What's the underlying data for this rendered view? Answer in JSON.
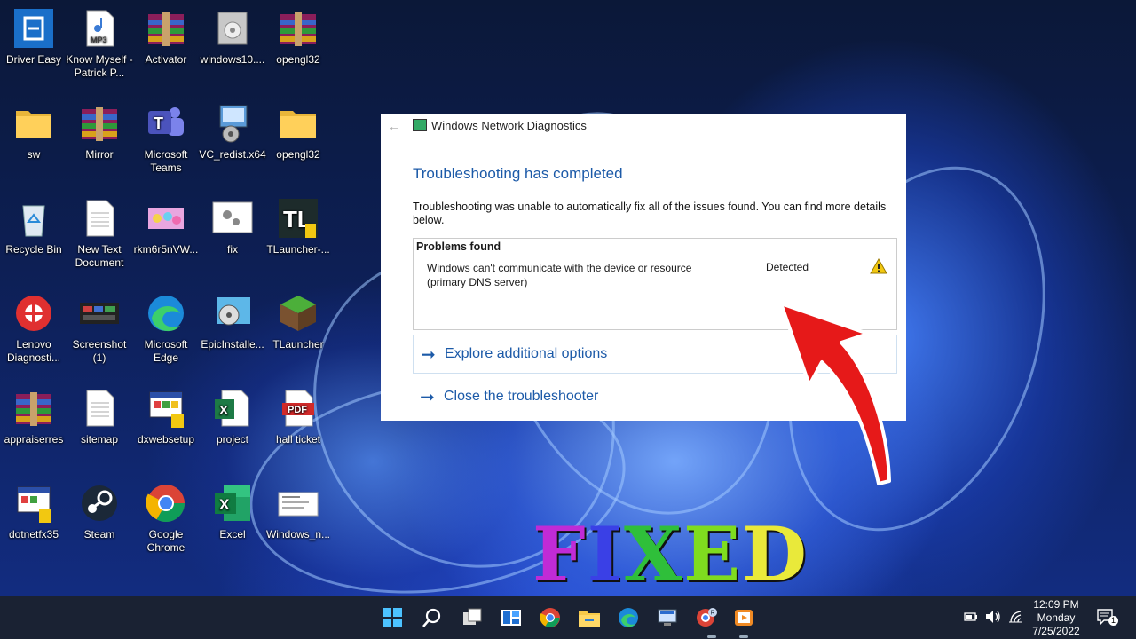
{
  "desktop_icons": [
    {
      "label": "Driver Easy",
      "icon": "driver-easy-icon"
    },
    {
      "label": "Know Myself - Patrick P...",
      "icon": "mp3-file-icon",
      "badge": "MP3"
    },
    {
      "label": "Activator",
      "icon": "winrar-icon"
    },
    {
      "label": "windows10....",
      "icon": "installer-icon"
    },
    {
      "label": "opengl32",
      "icon": "winrar-icon"
    },
    {
      "label": "sw",
      "icon": "folder-icon"
    },
    {
      "label": "Mirror",
      "icon": "winrar-icon"
    },
    {
      "label": "Microsoft Teams",
      "icon": "teams-icon"
    },
    {
      "label": "VC_redist.x64",
      "icon": "setup-icon"
    },
    {
      "label": "opengl32",
      "icon": "folder-icon"
    },
    {
      "label": "Recycle Bin",
      "icon": "recycle-bin-icon"
    },
    {
      "label": "New Text Document",
      "icon": "text-document-icon"
    },
    {
      "label": "rkm6r5nVW...",
      "icon": "image-file-icon"
    },
    {
      "label": "fix",
      "icon": "settings-file-icon"
    },
    {
      "label": "TLauncher-...",
      "icon": "tlauncher-installer-icon",
      "badge": "TL"
    },
    {
      "label": "Lenovo Diagnosti...",
      "icon": "lenovo-diagnostics-icon"
    },
    {
      "label": "Screenshot (1)",
      "icon": "screenshot-icon"
    },
    {
      "label": "Microsoft Edge",
      "icon": "edge-icon"
    },
    {
      "label": "EpicInstalle...",
      "icon": "epic-installer-icon"
    },
    {
      "label": "TLauncher",
      "icon": "minecraft-icon"
    },
    {
      "label": "appraiserres",
      "icon": "winrar-icon"
    },
    {
      "label": "sitemap",
      "icon": "text-document-icon"
    },
    {
      "label": "dxwebsetup",
      "icon": "dxwebsetup-icon"
    },
    {
      "label": "project",
      "icon": "excel-file-icon"
    },
    {
      "label": "hall ticket",
      "icon": "pdf-file-icon",
      "badge": "PDF"
    },
    {
      "label": "dotnetfx35",
      "icon": "dotnet-icon"
    },
    {
      "label": "Steam",
      "icon": "steam-icon"
    },
    {
      "label": "Google Chrome",
      "icon": "chrome-icon"
    },
    {
      "label": "Excel",
      "icon": "excel-icon"
    },
    {
      "label": "Windows_n...",
      "icon": "screenshot-file-icon"
    }
  ],
  "dialog": {
    "title": "Windows Network Diagnostics",
    "heading": "Troubleshooting has completed",
    "description": "Troubleshooting was unable to automatically fix all of the issues found. You can find more details below.",
    "problems_header": "Problems found",
    "problem": {
      "text": "Windows can't communicate with the device or resource (primary DNS server)",
      "status": "Detected",
      "icon": "warning-icon"
    },
    "links": [
      {
        "label": "Explore additional options"
      },
      {
        "label": "Close the troubleshooter"
      }
    ]
  },
  "overlay": {
    "fixed_text": [
      "F",
      "I",
      "X",
      "E",
      "D"
    ],
    "fixed_colors": [
      "#c02bd6",
      "#3a40e6",
      "#2fbf3a",
      "#7fdc1f",
      "#e9e93a"
    ],
    "arrow_color": "#e61919"
  },
  "taskbar": {
    "apps": [
      "start-icon",
      "search-icon",
      "task-view-icon",
      "widgets-icon",
      "chrome-icon",
      "file-explorer-icon",
      "edge-icon",
      "network-diagnostics-icon",
      "chrome-profile-icon",
      "media-player-icon"
    ],
    "clock_time": "12:09 PM",
    "clock_day": "Monday",
    "clock_date": "7/25/2022",
    "notification_count": "1"
  },
  "colors": {
    "link_blue": "#1c5aa8",
    "taskbar_bg": "#1a2233"
  }
}
